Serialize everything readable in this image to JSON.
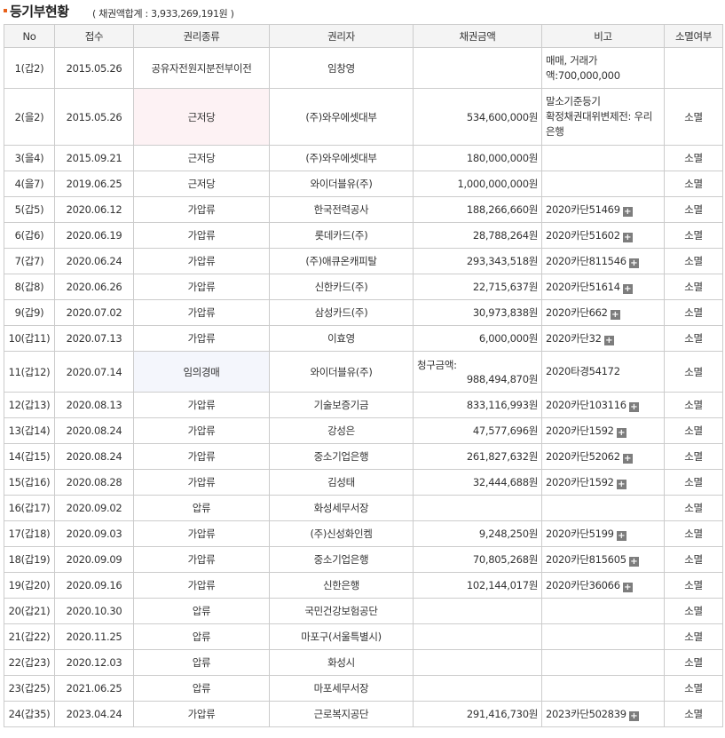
{
  "header": {
    "title": "등기부현황",
    "summary": "( 채권액합계 : 3,933,269,191원 )"
  },
  "columns": [
    "No",
    "접수",
    "권리종류",
    "권리자",
    "채권금액",
    "비고",
    "소멸여부"
  ],
  "rows": [
    {
      "no": "1(갑2)",
      "date": "2015.05.26",
      "type": "공유자전원지분전부이전",
      "holder": "임창영",
      "amount": "",
      "note": "매매, 거래가액:700,000,000",
      "extinct": ""
    },
    {
      "no": "2(을2)",
      "date": "2015.05.26",
      "type": "근저당",
      "holder": "(주)와우에셋대부",
      "amount": "534,600,000원",
      "note": "말소기준등기\n확정채권대위변제전: 우리은행",
      "extinct": "소멸"
    },
    {
      "no": "3(을4)",
      "date": "2015.09.21",
      "type": "근저당",
      "holder": "(주)와우에셋대부",
      "amount": "180,000,000원",
      "note": "",
      "extinct": "소멸"
    },
    {
      "no": "4(을7)",
      "date": "2019.06.25",
      "type": "근저당",
      "holder": "와이더블유(주)",
      "amount": "1,000,000,000원",
      "note": "",
      "extinct": "소멸"
    },
    {
      "no": "5(갑5)",
      "date": "2020.06.12",
      "type": "가압류",
      "holder": "한국전력공사",
      "amount": "188,266,660원",
      "note": "2020카단51469",
      "extinct": "소멸"
    },
    {
      "no": "6(갑6)",
      "date": "2020.06.19",
      "type": "가압류",
      "holder": "롯데카드(주)",
      "amount": "28,788,264원",
      "note": "2020카단51602",
      "extinct": "소멸"
    },
    {
      "no": "7(갑7)",
      "date": "2020.06.24",
      "type": "가압류",
      "holder": "(주)애큐온캐피탈",
      "amount": "293,343,518원",
      "note": "2020카단811546",
      "extinct": "소멸"
    },
    {
      "no": "8(갑8)",
      "date": "2020.06.26",
      "type": "가압류",
      "holder": "신한카드(주)",
      "amount": "22,715,637원",
      "note": "2020카단51614",
      "extinct": "소멸"
    },
    {
      "no": "9(갑9)",
      "date": "2020.07.02",
      "type": "가압류",
      "holder": "삼성카드(주)",
      "amount": "30,973,838원",
      "note": "2020카단662",
      "extinct": "소멸"
    },
    {
      "no": "10(갑11)",
      "date": "2020.07.13",
      "type": "가압류",
      "holder": "이효영",
      "amount": "6,000,000원",
      "note": "2020카단32",
      "extinct": "소멸"
    },
    {
      "no": "11(갑12)",
      "date": "2020.07.14",
      "type": "임의경매",
      "holder": "와이더블유(주)",
      "amount_label": "청구금액:",
      "amount": "988,494,870원",
      "note": "2020타경54172",
      "extinct": "소멸"
    },
    {
      "no": "12(갑13)",
      "date": "2020.08.13",
      "type": "가압류",
      "holder": "기술보증기금",
      "amount": "833,116,993원",
      "note": "2020카단103116",
      "extinct": "소멸"
    },
    {
      "no": "13(갑14)",
      "date": "2020.08.24",
      "type": "가압류",
      "holder": "강성은",
      "amount": "47,577,696원",
      "note": "2020카단1592",
      "extinct": "소멸"
    },
    {
      "no": "14(갑15)",
      "date": "2020.08.24",
      "type": "가압류",
      "holder": "중소기업은행",
      "amount": "261,827,632원",
      "note": "2020카단52062",
      "extinct": "소멸"
    },
    {
      "no": "15(갑16)",
      "date": "2020.08.28",
      "type": "가압류",
      "holder": "김성태",
      "amount": "32,444,688원",
      "note": "2020카단1592",
      "extinct": "소멸"
    },
    {
      "no": "16(갑17)",
      "date": "2020.09.02",
      "type": "압류",
      "holder": "화성세무서장",
      "amount": "",
      "note": "",
      "extinct": "소멸"
    },
    {
      "no": "17(갑18)",
      "date": "2020.09.03",
      "type": "가압류",
      "holder": "(주)신성화인켐",
      "amount": "9,248,250원",
      "note": "2020카단5199",
      "extinct": "소멸"
    },
    {
      "no": "18(갑19)",
      "date": "2020.09.09",
      "type": "가압류",
      "holder": "중소기업은행",
      "amount": "70,805,268원",
      "note": "2020카단815605",
      "extinct": "소멸"
    },
    {
      "no": "19(갑20)",
      "date": "2020.09.16",
      "type": "가압류",
      "holder": "신한은행",
      "amount": "102,144,017원",
      "note": "2020카단36066",
      "extinct": "소멸"
    },
    {
      "no": "20(갑21)",
      "date": "2020.10.30",
      "type": "압류",
      "holder": "국민건강보험공단",
      "amount": "",
      "note": "",
      "extinct": "소멸"
    },
    {
      "no": "21(갑22)",
      "date": "2020.11.25",
      "type": "압류",
      "holder": "마포구(서울특별시)",
      "amount": "",
      "note": "",
      "extinct": "소멸"
    },
    {
      "no": "22(갑23)",
      "date": "2020.12.03",
      "type": "압류",
      "holder": "화성시",
      "amount": "",
      "note": "",
      "extinct": "소멸"
    },
    {
      "no": "23(갑25)",
      "date": "2021.06.25",
      "type": "압류",
      "holder": "마포세무서장",
      "amount": "",
      "note": "",
      "extinct": "소멸"
    },
    {
      "no": "24(갑35)",
      "date": "2023.04.24",
      "type": "가압류",
      "holder": "근로복지공단",
      "amount": "291,416,730원",
      "note": "2023카단502839",
      "extinct": "소멸"
    }
  ],
  "plus_symbol": "+",
  "colors": {
    "bullet": "#e8611a",
    "highlight_red": "#fdf2f4",
    "highlight_blue": "#f4f6fc"
  }
}
